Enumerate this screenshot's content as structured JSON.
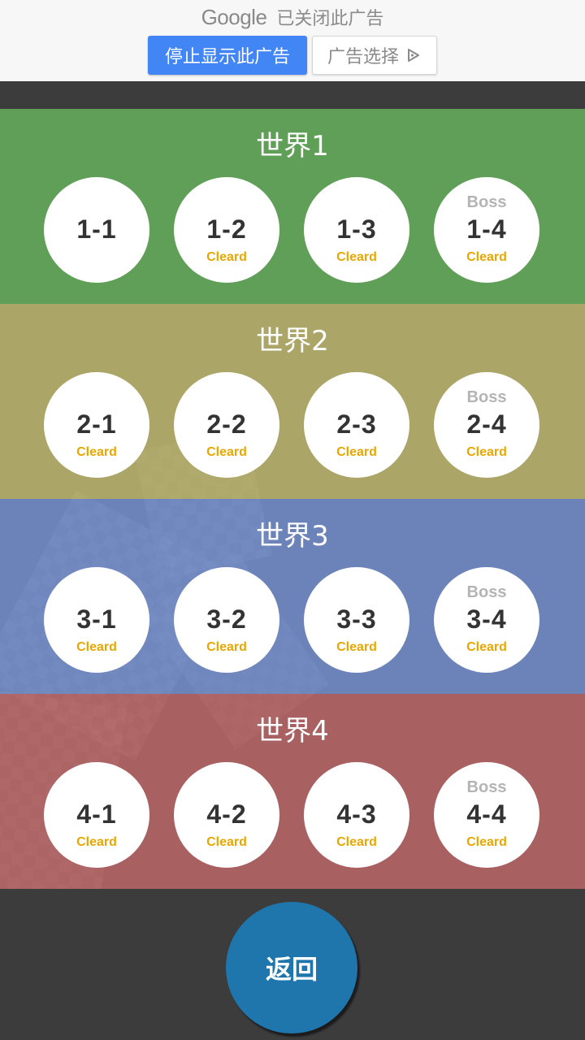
{
  "ad": {
    "brand": "Google",
    "closed_text": "已关闭此广告",
    "stop_button": "停止显示此广告",
    "choice_button": "广告选择",
    "choice_icon": "adchoices-icon",
    "colors": {
      "stop_bg": "#4285f4",
      "banner_bg": "#f7f7f7"
    }
  },
  "worlds": [
    {
      "title": "世界1",
      "color": "#60a258",
      "levels": [
        {
          "num": "1-1",
          "status": "",
          "boss": ""
        },
        {
          "num": "1-2",
          "status": "Cleard",
          "boss": ""
        },
        {
          "num": "1-3",
          "status": "Cleard",
          "boss": ""
        },
        {
          "num": "1-4",
          "status": "Cleard",
          "boss": "Boss"
        }
      ]
    },
    {
      "title": "世界2",
      "color": "#bcb46e",
      "levels": [
        {
          "num": "2-1",
          "status": "Cleard",
          "boss": ""
        },
        {
          "num": "2-2",
          "status": "Cleard",
          "boss": ""
        },
        {
          "num": "2-3",
          "status": "Cleard",
          "boss": ""
        },
        {
          "num": "2-4",
          "status": "Cleard",
          "boss": "Boss"
        }
      ]
    },
    {
      "title": "世界3",
      "color": "#7692d6",
      "levels": [
        {
          "num": "3-1",
          "status": "Cleard",
          "boss": ""
        },
        {
          "num": "3-2",
          "status": "Cleard",
          "boss": ""
        },
        {
          "num": "3-3",
          "status": "Cleard",
          "boss": ""
        },
        {
          "num": "3-4",
          "status": "Cleard",
          "boss": "Boss"
        }
      ]
    },
    {
      "title": "世界4",
      "color": "#c06868",
      "levels": [
        {
          "num": "4-1",
          "status": "Cleard",
          "boss": ""
        },
        {
          "num": "4-2",
          "status": "Cleard",
          "boss": ""
        },
        {
          "num": "4-3",
          "status": "Cleard",
          "boss": ""
        },
        {
          "num": "4-4",
          "status": "Cleard",
          "boss": "Boss"
        }
      ]
    }
  ],
  "back_button": "返回",
  "colors": {
    "status_text": "#e6a700",
    "boss_text": "#b4b4b4",
    "back_button": "#1f76ad",
    "background": "#3c3c3c"
  }
}
